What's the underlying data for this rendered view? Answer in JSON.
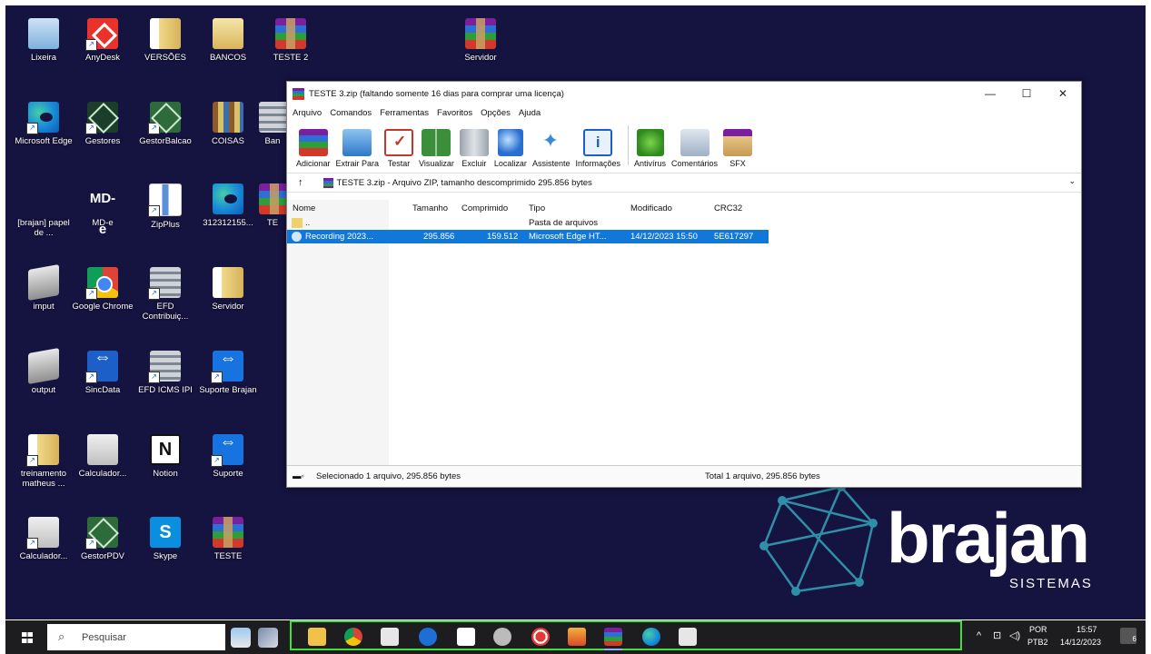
{
  "desktop": {
    "icons": [
      {
        "label": "Lixeira"
      },
      {
        "label": "AnyDesk"
      },
      {
        "label": "VERSÕES"
      },
      {
        "label": "BANCOS"
      },
      {
        "label": "TESTE 2"
      },
      {
        "label": "Servidor"
      },
      {
        "label": "Microsoft Edge"
      },
      {
        "label": "Gestores"
      },
      {
        "label": "GestorBalcao"
      },
      {
        "label": "COISAS"
      },
      {
        "label": "Ban"
      },
      {
        "label": "[brajan] papel de ..."
      },
      {
        "label": "MD-e"
      },
      {
        "label": "ZipPlus"
      },
      {
        "label": "312312155..."
      },
      {
        "label": "TE"
      },
      {
        "label": "imput"
      },
      {
        "label": "Google Chrome"
      },
      {
        "label": "EFD Contribuiç..."
      },
      {
        "label": "Servidor"
      },
      {
        "label": "output"
      },
      {
        "label": "SincData"
      },
      {
        "label": "EFD ICMS IPI"
      },
      {
        "label": "Suporte Brajan"
      },
      {
        "label": "treinamento matheus ..."
      },
      {
        "label": "Calculador..."
      },
      {
        "label": "Notion"
      },
      {
        "label": "Suporte"
      },
      {
        "label": "Calculador..."
      },
      {
        "label": "GestorPDV"
      },
      {
        "label": "Skype"
      },
      {
        "label": "TESTE"
      }
    ],
    "mde_glyph": "MD-e",
    "notion_glyph": "N",
    "skype_glyph": "S"
  },
  "window": {
    "title": "TESTE 3.zip (faltando somente 16 dias para comprar uma licença)",
    "controls": {
      "minimize": "—",
      "maximize": "☐",
      "close": "✕"
    },
    "menu": [
      "Arquivo",
      "Comandos",
      "Ferramentas",
      "Favoritos",
      "Opções",
      "Ajuda"
    ],
    "toolbar": [
      {
        "label": "Adicionar"
      },
      {
        "label": "Extrair Para"
      },
      {
        "label": "Testar"
      },
      {
        "label": "Visualizar"
      },
      {
        "label": "Excluir"
      },
      {
        "label": "Localizar"
      },
      {
        "label": "Assistente"
      },
      {
        "label": "Informações"
      },
      {
        "label": "Antivírus"
      },
      {
        "label": "Comentários"
      },
      {
        "label": "SFX"
      }
    ],
    "address": {
      "up": "↑",
      "path": "TESTE 3.zip - Arquivo ZIP, tamanho descomprimido 295.856 bytes",
      "dropdown": "⌄"
    },
    "columns": [
      "Nome",
      "Tamanho",
      "Comprimido",
      "Tipo",
      "Modificado",
      "CRC32"
    ],
    "rows": [
      {
        "name": "..",
        "size": "",
        "packed": "",
        "type": "Pasta de arquivos",
        "modified": "",
        "crc": "",
        "selected": false
      },
      {
        "name": "Recording 2023...",
        "size": "295.856",
        "packed": "159.512",
        "type": "Microsoft Edge HT...",
        "modified": "14/12/2023 15:50",
        "crc": "5E617297",
        "selected": true
      }
    ],
    "status": {
      "left": "Selecionado 1 arquivo, 295.856 bytes",
      "right": "Total 1 arquivo, 295.856 bytes"
    }
  },
  "brand": {
    "name": "brajan",
    "sub": "SISTEMAS"
  },
  "taskbar": {
    "search_placeholder": "Pesquisar",
    "search_icon": "⌕",
    "tray": {
      "chevron": "^",
      "lang1": "POR",
      "lang2": "PTB2",
      "time": "15:57",
      "date": "14/12/2023",
      "notifications": "6"
    }
  }
}
